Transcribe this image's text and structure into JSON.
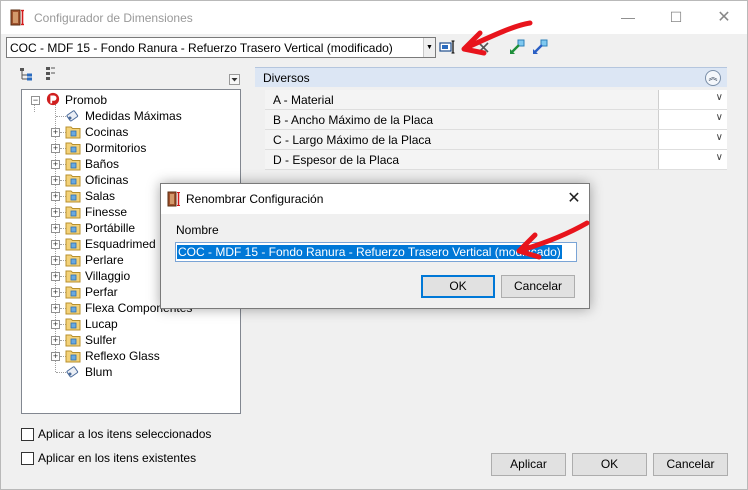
{
  "window": {
    "title": "Configurador de Dimensiones",
    "controls": {
      "minimize": "—",
      "maximize": "☐",
      "close": "✕"
    }
  },
  "toolbar": {
    "config_value": "COC - MDF 15 - Fondo Ranura - Refuerzo Trasero Vertical (modificado)",
    "dropdown_glyph": "▼",
    "icons": [
      "rename-icon",
      "delete-icon",
      "import-icon",
      "export-icon"
    ]
  },
  "tree": {
    "root": "Promob",
    "items": [
      {
        "label": "Medidas Máximas",
        "type": "leaf"
      },
      {
        "label": "Cocinas",
        "type": "folder"
      },
      {
        "label": "Dormitorios",
        "type": "folder"
      },
      {
        "label": "Baños",
        "type": "folder"
      },
      {
        "label": "Oficinas",
        "type": "folder"
      },
      {
        "label": "Salas",
        "type": "folder"
      },
      {
        "label": "Finesse",
        "type": "folder"
      },
      {
        "label": "Portábille",
        "type": "folder"
      },
      {
        "label": "Esquadrimed",
        "type": "folder"
      },
      {
        "label": "Perlare",
        "type": "folder"
      },
      {
        "label": "Villaggio",
        "type": "folder"
      },
      {
        "label": "Perfar",
        "type": "folder"
      },
      {
        "label": "Flexa Componentes",
        "type": "folder"
      },
      {
        "label": "Lucap",
        "type": "folder"
      },
      {
        "label": "Sulfer",
        "type": "folder"
      },
      {
        "label": "Reflexo Glass",
        "type": "folder"
      },
      {
        "label": "Blum",
        "type": "leaf"
      }
    ]
  },
  "properties": {
    "group": "Diversos",
    "rows": [
      {
        "label": "A - Material",
        "value": ""
      },
      {
        "label": "B -  Ancho Máximo de la Placa",
        "value": ""
      },
      {
        "label": "C - Largo Máximo de la Placa",
        "value": ""
      },
      {
        "label": "D - Espesor de la Placa",
        "value": ""
      }
    ]
  },
  "options": {
    "apply_selected": "Aplicar a los itens seleccionados",
    "apply_existing": "Aplicar en los itens existentes"
  },
  "buttons": {
    "apply": "Aplicar",
    "ok": "OK",
    "cancel": "Cancelar"
  },
  "dialog": {
    "title": "Renombrar Configuración",
    "name_label": "Nombre",
    "name_value": "COC - MDF 15 - Fondo Ranura - Refuerzo Trasero Vertical (modificado)",
    "ok": "OK",
    "cancel": "Cancelar"
  },
  "colors": {
    "selection": "#0078d7",
    "group_header": "#dce6f4",
    "annotation_arrow": "#e8141c"
  }
}
